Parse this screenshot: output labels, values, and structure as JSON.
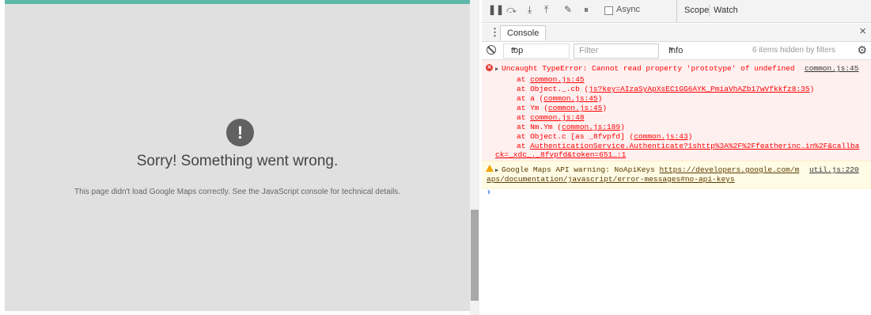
{
  "map": {
    "error_icon": "!",
    "title": "Sorry! Something went wrong.",
    "detail": "This page didn't load Google Maps correctly. See the JavaScript console for technical details."
  },
  "devtools": {
    "debugger": {
      "icons": [
        "pause-icon",
        "step-over-icon",
        "step-into-icon",
        "step-out-icon",
        "deactivate-breakpoints-icon",
        "pause-on-exceptions-icon"
      ],
      "async_label": "Async",
      "tabs": [
        "Scope",
        "Watch"
      ]
    },
    "drawer": {
      "tab": "Console",
      "close": "×"
    },
    "filter_bar": {
      "context": "top",
      "filter_placeholder": "Filter",
      "level": "Info",
      "hidden_items": "6 items hidden by filters"
    },
    "error": {
      "message": "Uncaught TypeError: Cannot read property 'prototype' of undefined",
      "source": "common.js:45",
      "stack": [
        {
          "prefix": "at ",
          "link": "common.js:45",
          "suffix": ""
        },
        {
          "prefix": "at Object._.cb (",
          "link": "js?key=AIzaSyApXsEC1GG6AYK_PmiaVhAZb17wVfkkfz8:35",
          "suffix": ")"
        },
        {
          "prefix": "at a (",
          "link": "common.js:45",
          "suffix": ")"
        },
        {
          "prefix": "at Ym (",
          "link": "common.js:45",
          "suffix": ")"
        },
        {
          "prefix": "at ",
          "link": "common.js:48",
          "suffix": ""
        },
        {
          "prefix": "at Nm.Ym (",
          "link": "common.js:189",
          "suffix": ")"
        },
        {
          "prefix": "at Object.c [as _8fvpfd] (",
          "link": "common.js:43",
          "suffix": ")"
        },
        {
          "prefix": "at ",
          "link": "AuthenticationService.Authenticate?1shttp%3A%2F%2Ffeatherinc.in%2F&callba",
          "suffix": ""
        }
      ],
      "stack_wrap": "ck=_xdc_._8fvpfd&token=651…:1"
    },
    "warning": {
      "prefix": "Google Maps API warning: NoApiKeys ",
      "link_part1": "https://developers.google.com/m",
      "link_part2": "aps/documentation/javascript/error-messages#no-api-keys",
      "source": "util.js:220"
    },
    "prompt": "›"
  }
}
